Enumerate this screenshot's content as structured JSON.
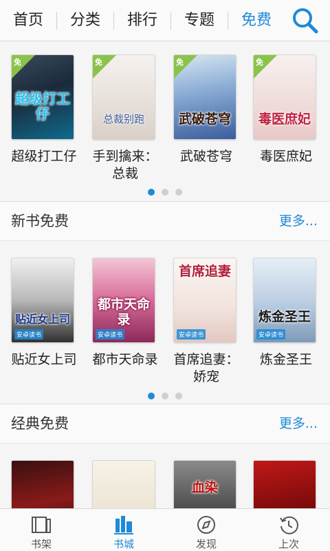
{
  "nav": {
    "tabs": [
      {
        "label": "首页"
      },
      {
        "label": "分类"
      },
      {
        "label": "排行"
      },
      {
        "label": "专题"
      },
      {
        "label": "免费"
      }
    ],
    "active_tab": "免费",
    "accent_color": "#1e8ad6"
  },
  "featured": {
    "books": [
      {
        "name": "超级打工仔",
        "cover_text": "超级打工仔",
        "badge": "免"
      },
      {
        "name": "手到擒来：总裁",
        "cover_text": "总裁别跑",
        "badge": "免"
      },
      {
        "name": "武破苍穹",
        "cover_text": "武破苍穹",
        "badge": "免"
      },
      {
        "name": "毒医庶妃",
        "cover_text": "毒医庶妃",
        "badge": "免"
      }
    ]
  },
  "new_free": {
    "title": "新书免费",
    "more": "更多...",
    "books": [
      {
        "name": "贴近女上司",
        "cover_text": "贴近女上司",
        "tag": "安卓读书"
      },
      {
        "name": "都市天命录",
        "cover_text": "都市天命录",
        "tag": "安卓读书"
      },
      {
        "name": "首席追妻：娇宠",
        "cover_text": "首席追妻",
        "tag": "安卓读书"
      },
      {
        "name": "炼金圣王",
        "cover_text": "炼金圣王",
        "tag": "安卓读书"
      }
    ]
  },
  "classic_free": {
    "title": "经典免费",
    "more": "更多...",
    "books": [
      {
        "cover_text": ""
      },
      {
        "cover_text": ""
      },
      {
        "cover_text": "血染"
      },
      {
        "cover_text": ""
      }
    ]
  },
  "bottom_nav": {
    "items": [
      {
        "label": "书架",
        "icon": "bookshelf-icon"
      },
      {
        "label": "书城",
        "icon": "bookstore-icon"
      },
      {
        "label": "发现",
        "icon": "compass-icon"
      },
      {
        "label": "上次",
        "icon": "history-icon"
      }
    ],
    "active": "书城"
  }
}
